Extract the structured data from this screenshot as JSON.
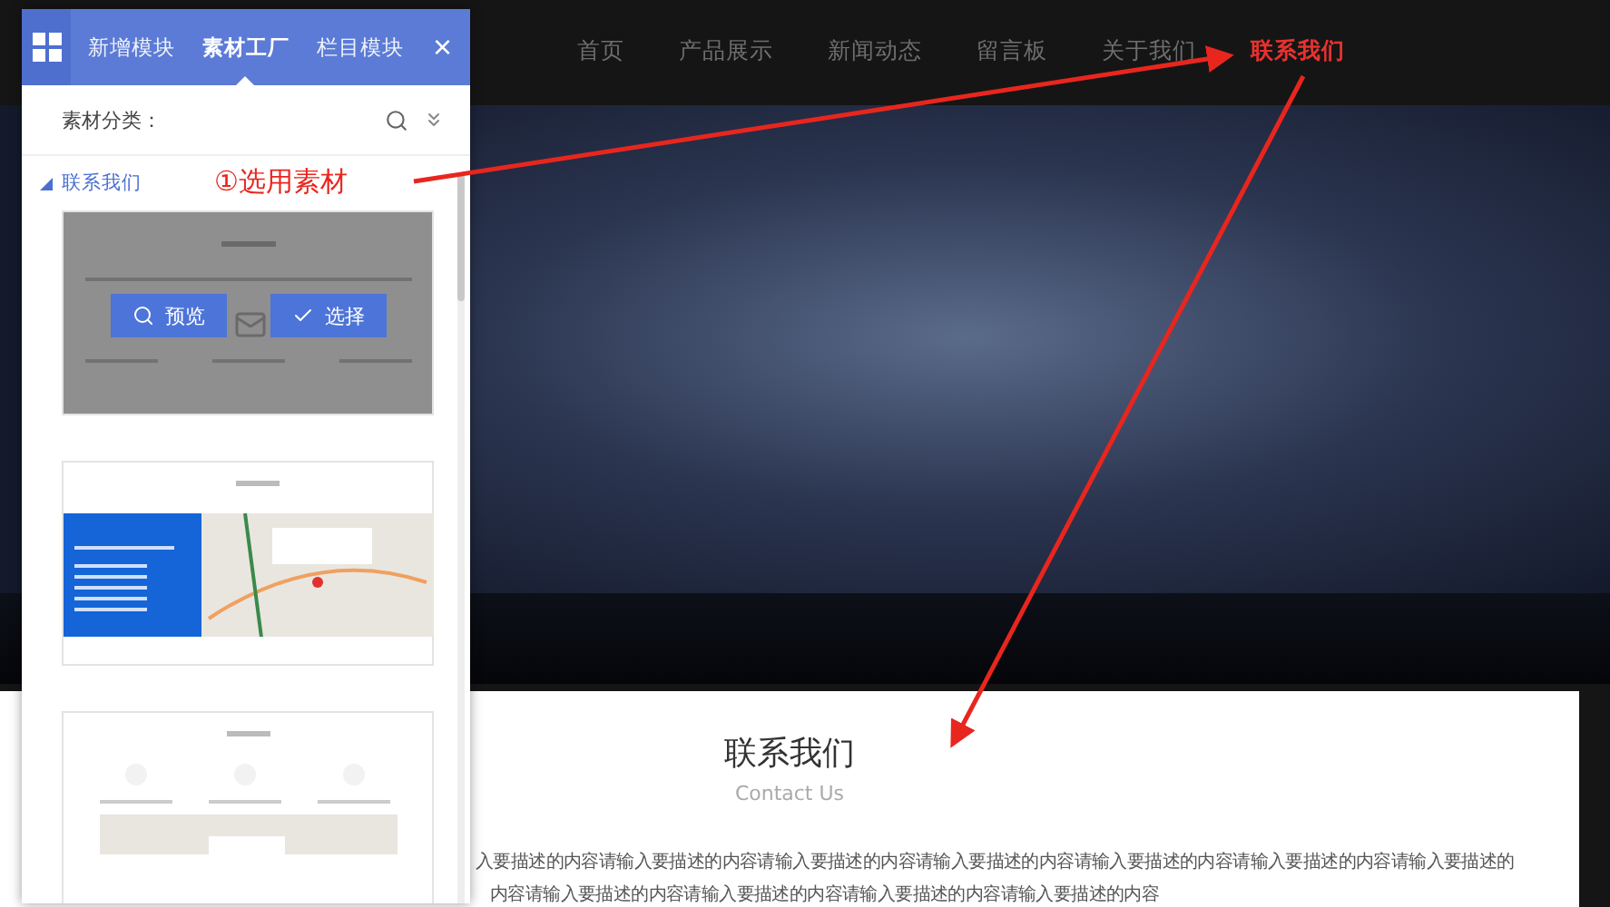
{
  "nav": {
    "items": [
      {
        "label": "首页",
        "selected": false
      },
      {
        "label": "产品展示",
        "selected": false
      },
      {
        "label": "新闻动态",
        "selected": false
      },
      {
        "label": "留言板",
        "selected": false
      },
      {
        "label": "关于我们",
        "selected": false
      },
      {
        "label": "联系我们",
        "selected": true
      }
    ]
  },
  "section": {
    "title": "联系我们",
    "subtitle": "Contact Us",
    "lines": [
      "入要描述的内容请输入要描述的内容请输入要描述的内容请输入要描述的内容请输入要描述的内容请输入要描述的内容请输入要描述的",
      "内容请输入要描述的内容请输入要描述的内容请输入要描述的内容请输入要描述的内容"
    ]
  },
  "panel": {
    "tabs": [
      {
        "label": "新增模块",
        "selected": false
      },
      {
        "label": "素材工厂",
        "selected": true
      },
      {
        "label": "栏目模块",
        "selected": false
      }
    ],
    "close": "×",
    "filter_label": "素材分类：",
    "category": {
      "label": "联系我们",
      "expanded": true
    },
    "templates": [
      {
        "kind": "grid",
        "hovered": true
      },
      {
        "kind": "map",
        "hovered": false
      },
      {
        "kind": "icons",
        "hovered": false
      }
    ],
    "hover_buttons": {
      "preview": "预览",
      "select": "选择"
    }
  },
  "annotation": "①选用素材"
}
